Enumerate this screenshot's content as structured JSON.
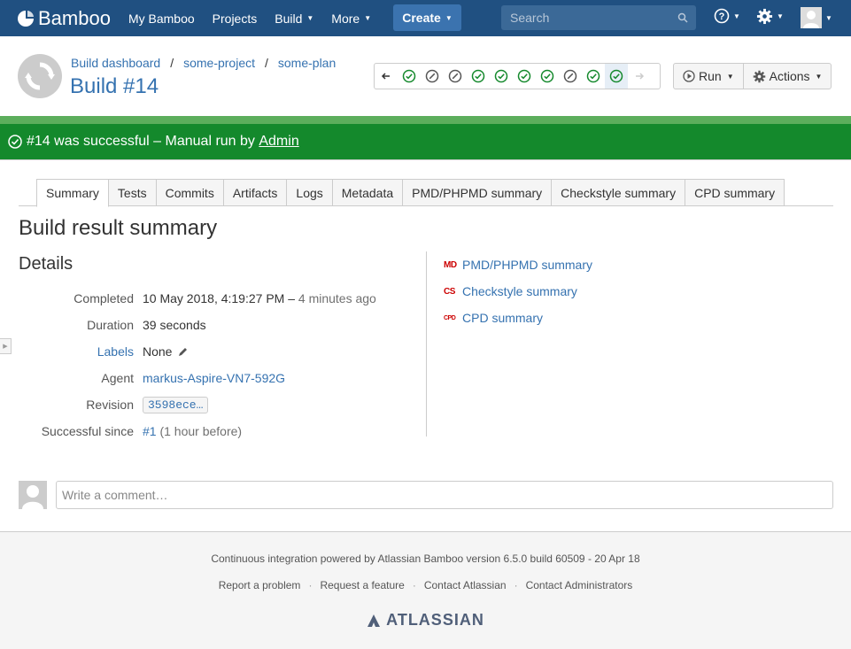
{
  "header": {
    "logo_text": "Bamboo",
    "nav": [
      {
        "label": "My Bamboo",
        "dropdown": false
      },
      {
        "label": "Projects",
        "dropdown": false
      },
      {
        "label": "Build",
        "dropdown": true
      },
      {
        "label": "More",
        "dropdown": true
      }
    ],
    "create_label": "Create",
    "search_placeholder": "Search",
    "bg_color": "#205081"
  },
  "page": {
    "breadcrumbs": [
      "Build dashboard",
      "some-project",
      "some-plan"
    ],
    "title": "Build #14"
  },
  "history": {
    "items": [
      "prev-arrow",
      "success",
      "not-built",
      "not-built",
      "success",
      "success",
      "success",
      "success",
      "not-built",
      "success",
      "success-current",
      "next-arrow"
    ]
  },
  "actions": {
    "run_label": "Run",
    "actions_label": "Actions"
  },
  "status": {
    "text": "#14 was successful – Manual run by ",
    "user": "Admin",
    "color": "#14892c"
  },
  "tabs": [
    "Summary",
    "Tests",
    "Commits",
    "Artifacts",
    "Logs",
    "Metadata",
    "PMD/PHPMD summary",
    "Checkstyle summary",
    "CPD summary"
  ],
  "summary": {
    "heading": "Build result summary",
    "details_heading": "Details",
    "completed_label": "Completed",
    "completed_value": "10 May 2018, 4:19:27 PM – ",
    "completed_ago": "4 minutes ago",
    "duration_label": "Duration",
    "duration_value": "39 seconds",
    "labels_label": "Labels",
    "labels_value": "None",
    "agent_label": "Agent",
    "agent_value": "markus-Aspire-VN7-592G",
    "revision_label": "Revision",
    "revision_value": "3598ece…",
    "since_label": "Successful since",
    "since_link": "#1",
    "since_rest": " (1 hour before)"
  },
  "side_links": [
    {
      "badge": "MD",
      "label": "PMD/PHPMD summary"
    },
    {
      "badge": "CS",
      "label": "Checkstyle summary"
    },
    {
      "badge": "CPD",
      "label": "CPD summary"
    }
  ],
  "comment": {
    "placeholder": "Write a comment…"
  },
  "footer": {
    "powered": "Continuous integration powered by Atlassian Bamboo version 6.5.0 build 60509 - 20 Apr 18",
    "links": [
      "Report a problem",
      "Request a feature",
      "Contact Atlassian",
      "Contact Administrators"
    ],
    "brand": "ATLASSIAN"
  }
}
